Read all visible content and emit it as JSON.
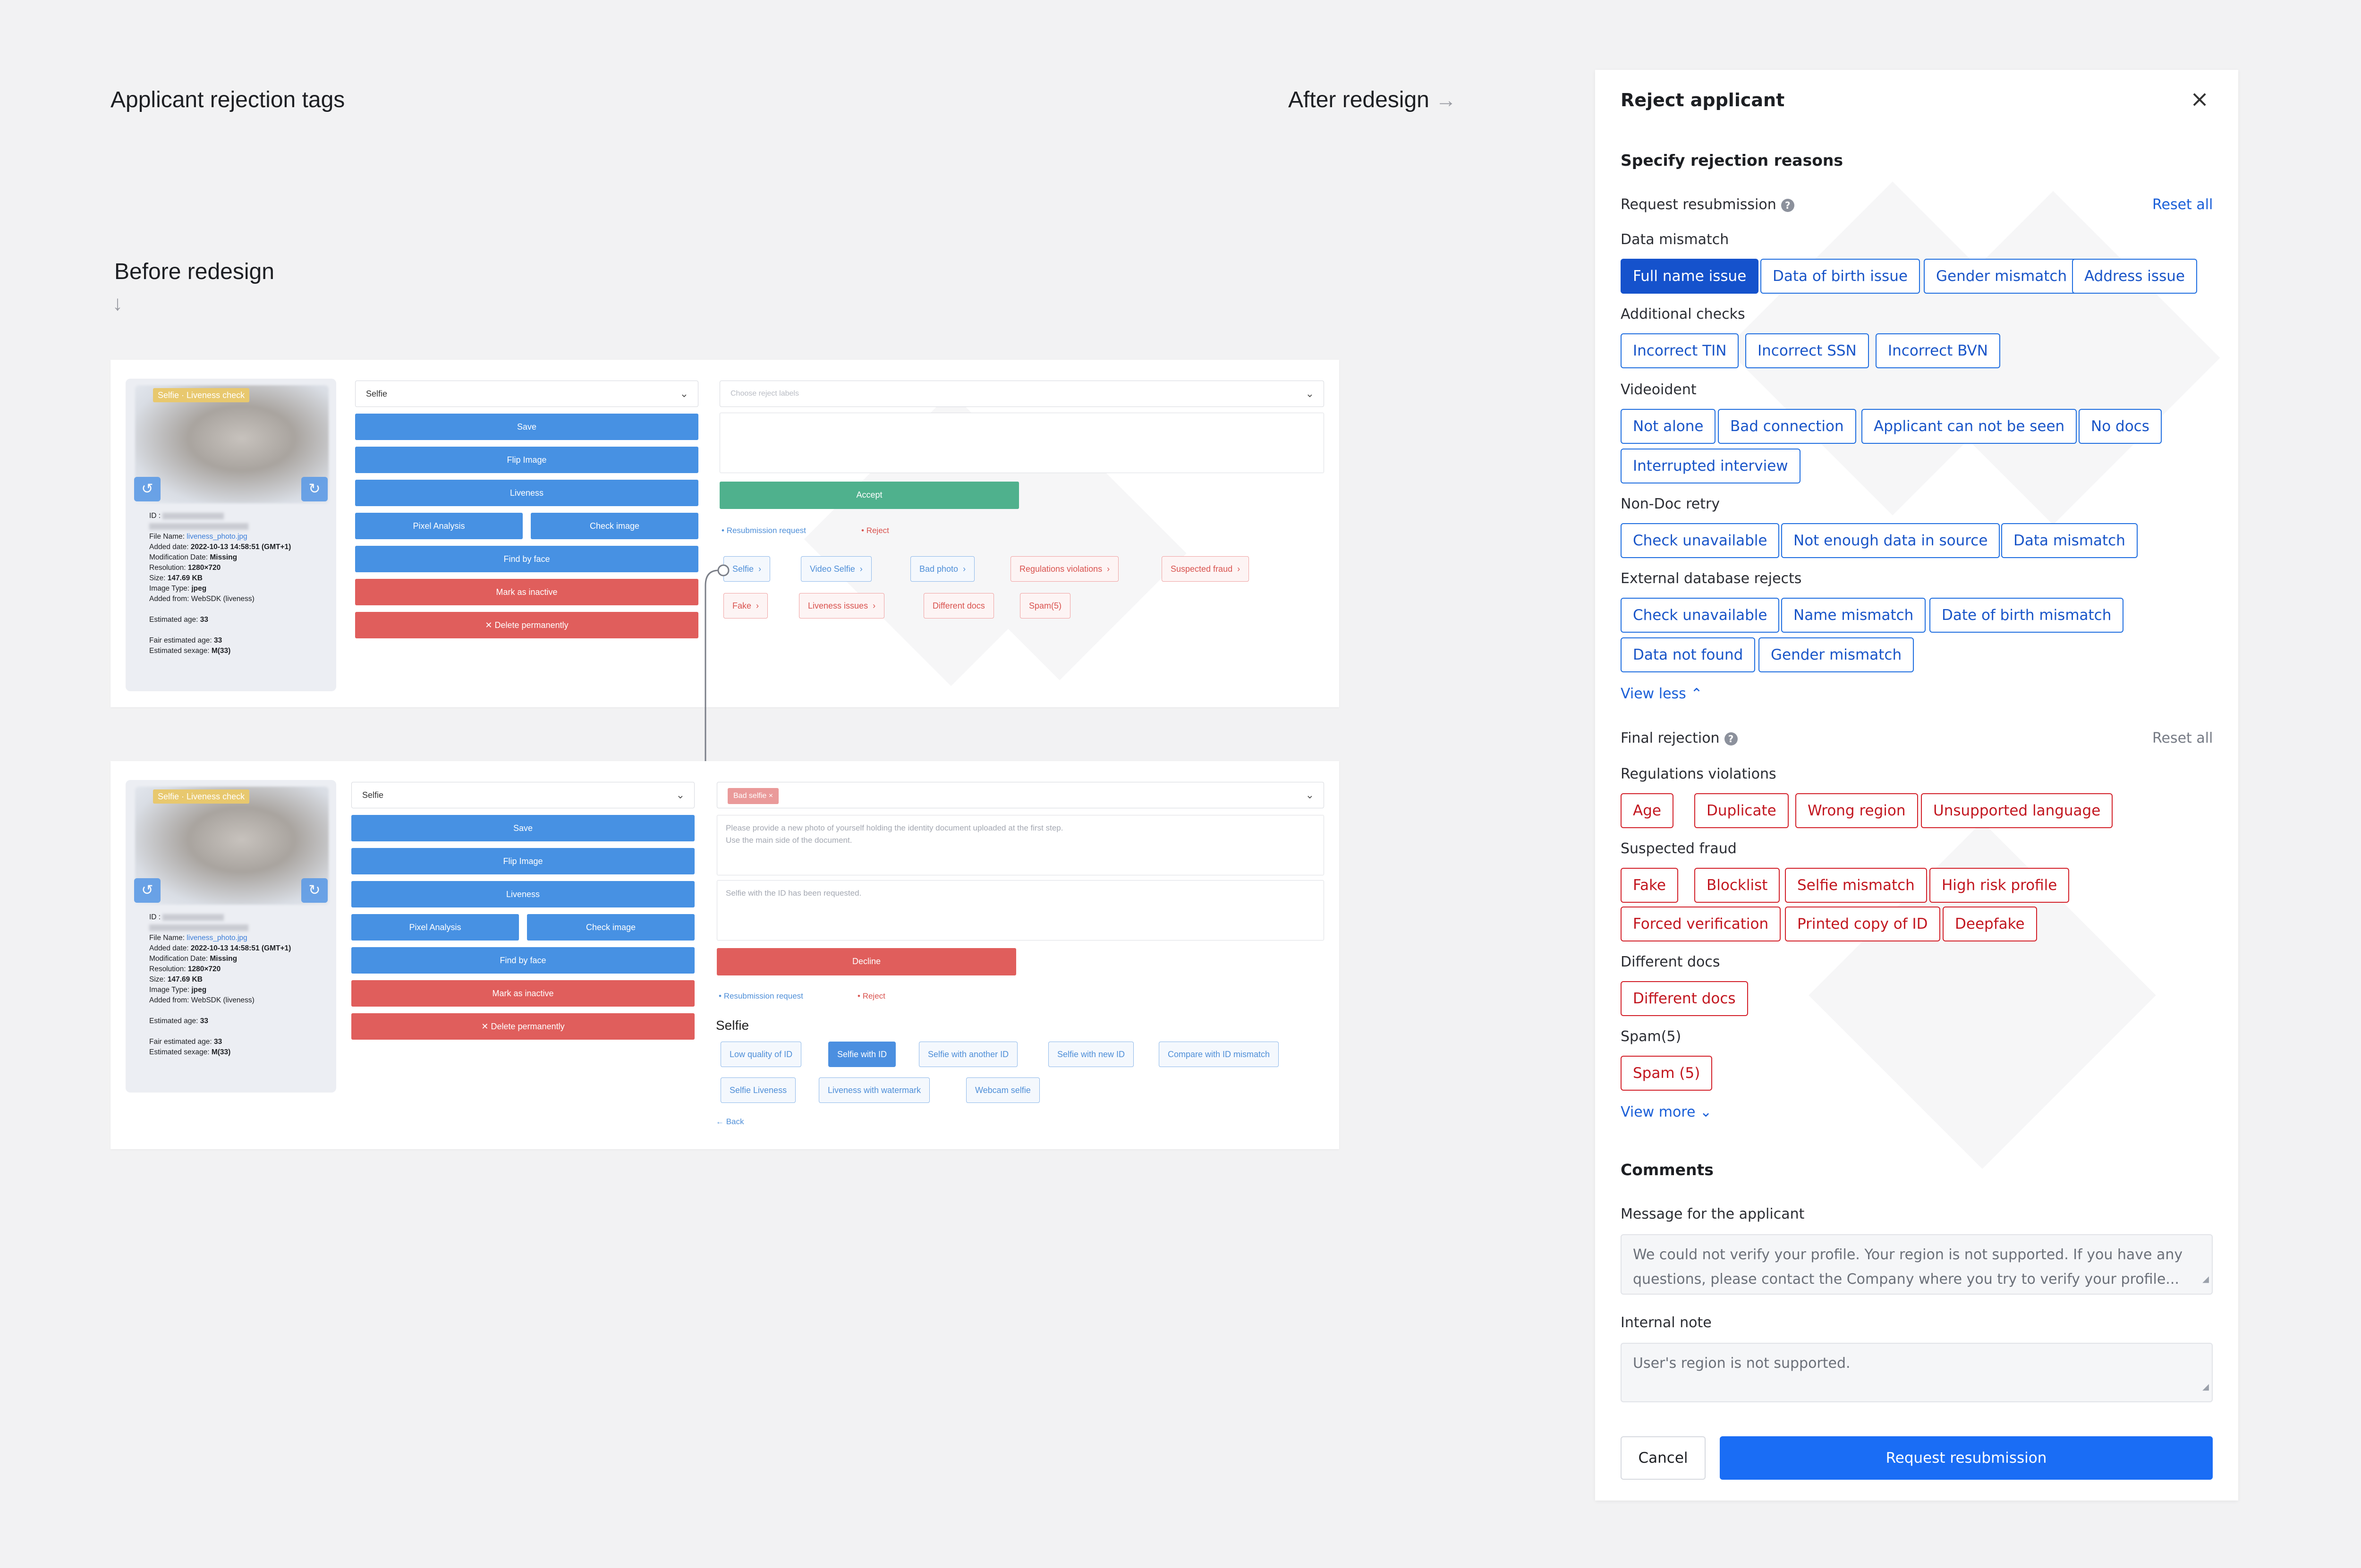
{
  "headings": {
    "main_title": "Applicant rejection tags",
    "after_label": "After redesign",
    "after_arrow": "→",
    "before_label": "Before redesign",
    "before_arrow": "↓"
  },
  "old_card_1": {
    "thumb_label": "Selfie · Liveness check",
    "meta": {
      "id_label": "ID :",
      "file_name_label": "File Name:",
      "file_name": "liveness_photo.jpg",
      "added_label": "Added date:",
      "added": "2022-10-13 14:58:51 (GMT+1)",
      "mod_label": "Modification Date:",
      "mod": "Missing",
      "res_label": "Resolution:",
      "res": "1280×720",
      "size_label": "Size:",
      "size": "147.69 KB",
      "type_label": "Image Type:",
      "type": "jpeg",
      "from_label": "Added from:",
      "from": "WebSDK (liveness)",
      "age_label": "Estimated age:",
      "age": "33",
      "fair_label": "Fair estimated age:",
      "fair": "33",
      "sex_label": "Estimated sexage:",
      "sex": "M(33)"
    },
    "select_value": "Selfie",
    "buttons": {
      "save": "Save",
      "flip": "Flip Image",
      "liveness": "Liveness",
      "pixel": "Pixel Analysis",
      "check": "Check image",
      "find": "Find by face",
      "inactive": "Mark as inactive",
      "delete": "Delete permanently"
    },
    "labels_placeholder": "Choose reject labels",
    "accept": "Accept",
    "link_resubmission": "Resubmission request",
    "link_reject": "Reject",
    "tags_blue": [
      "Selfie",
      "Video Selfie",
      "Bad photo"
    ],
    "tags_red_row1": [
      "Regulations violations",
      "Suspected fraud"
    ],
    "tags_red_row2": [
      "Fake",
      "Liveness issues",
      "Different docs",
      "Spam(5)"
    ]
  },
  "old_card_2": {
    "select_value": "Selfie",
    "chip_bad_selfie": "Bad selfie",
    "message_1": "Please provide a new photo of yourself holding the identity document uploaded at the first step.",
    "message_2": "Use the main side of the document.",
    "message_3": "Selfie with the ID has been requested.",
    "decline": "Decline",
    "link_resubmission": "Resubmission request",
    "link_reject": "Reject",
    "group_title": "Selfie",
    "tags_row1": [
      "Low quality of ID",
      "Selfie with ID",
      "Selfie with another ID",
      "Selfie with new ID",
      "Compare with ID mismatch"
    ],
    "tags_row2": [
      "Selfie Liveness",
      "Liveness with watermark",
      "Webcam selfie"
    ],
    "back": "← Back"
  },
  "panel": {
    "title": "Reject applicant",
    "close_icon": "×",
    "specify": "Specify rejection reasons",
    "resubmission": {
      "title": "Request resubmission",
      "reset": "Reset all",
      "data_mismatch": {
        "label": "Data mismatch",
        "chips": [
          "Full name issue",
          "Data of birth issue",
          "Gender mismatch",
          "Address issue"
        ]
      },
      "additional": {
        "label": "Additional checks",
        "chips": [
          "Incorrect TIN",
          "Incorrect SSN",
          "Incorrect BVN"
        ]
      },
      "videoident": {
        "label": "Videoident",
        "chips": [
          "Not alone",
          "Bad connection",
          "Applicant can not be seen",
          "No docs",
          "Interrupted interview"
        ]
      },
      "nondoc": {
        "label": "Non-Doc retry",
        "chips": [
          "Check unavailable",
          "Not enough data in source",
          "Data mismatch"
        ]
      },
      "external": {
        "label": "External database rejects",
        "chips": [
          "Check unavailable",
          "Name mismatch",
          "Date of birth mismatch",
          "Data not found",
          "Gender mismatch"
        ]
      },
      "view_less": "View less"
    },
    "final": {
      "title": "Final rejection",
      "reset": "Reset all",
      "regulations": {
        "label": "Regulations violations",
        "chips": [
          "Age",
          "Duplicate",
          "Wrong region",
          "Unsupported language"
        ]
      },
      "fraud": {
        "label": "Suspected fraud",
        "chips": [
          "Fake",
          "Blocklist",
          "Selfie mismatch",
          "High risk profile",
          "Forced verification",
          "Printed copy of ID",
          "Deepfake"
        ]
      },
      "docs": {
        "label": "Different docs",
        "chips": [
          "Different docs"
        ]
      },
      "spam": {
        "label": "Spam(5)",
        "chips": [
          "Spam (5)"
        ]
      },
      "view_more": "View more"
    },
    "comments": {
      "title": "Comments",
      "message_label": "Message for the applicant",
      "message_line1": "We could not verify your profile. Your region is not supported. If you have any",
      "message_line2": "questions, please contact the Company where you try to verify your profile...",
      "note_label": "Internal note",
      "note_value": "User's region is not supported."
    },
    "cancel": "Cancel",
    "submit": "Request resubmission",
    "colors": {
      "primary": "#1a6df5",
      "selected_chip": "#1552cc",
      "danger": "#d32029"
    }
  }
}
